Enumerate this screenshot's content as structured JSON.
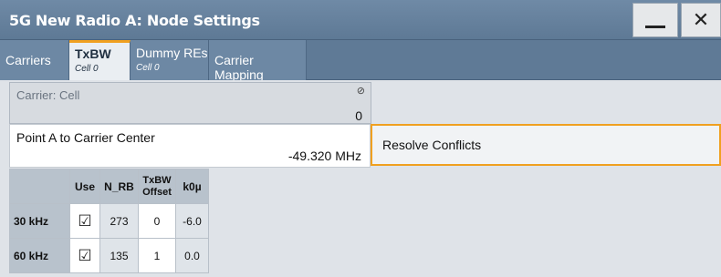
{
  "window": {
    "title": "5G New Radio A: Node Settings",
    "min_label": "—",
    "close_label": "✕"
  },
  "tabs": [
    {
      "label": "Carriers",
      "sub": ""
    },
    {
      "label": "TxBW",
      "sub": "Cell 0"
    },
    {
      "label": "Dummy REs",
      "sub": "Cell 0"
    },
    {
      "label": "Carrier Mapping",
      "sub": ""
    }
  ],
  "carrier": {
    "label": "Carrier: Cell",
    "value": "0",
    "lock_icon": "⊘"
  },
  "point_a": {
    "label": "Point A to Carrier Center",
    "value": "-49.320 MHz"
  },
  "resolve": {
    "label": "Resolve Conflicts"
  },
  "table": {
    "headers": [
      "",
      "Use",
      "N_RB",
      "TxBW Offset",
      "k0µ"
    ],
    "header_offset_line1": "TxBW",
    "header_offset_line2": "Offset",
    "rows": [
      {
        "scs": "30 kHz",
        "use": "☑",
        "nrb": "273",
        "offset": "0",
        "k0": "-6.0"
      },
      {
        "scs": "60 kHz",
        "use": "☑",
        "nrb": "135",
        "offset": "1",
        "k0": "0.0"
      }
    ]
  }
}
